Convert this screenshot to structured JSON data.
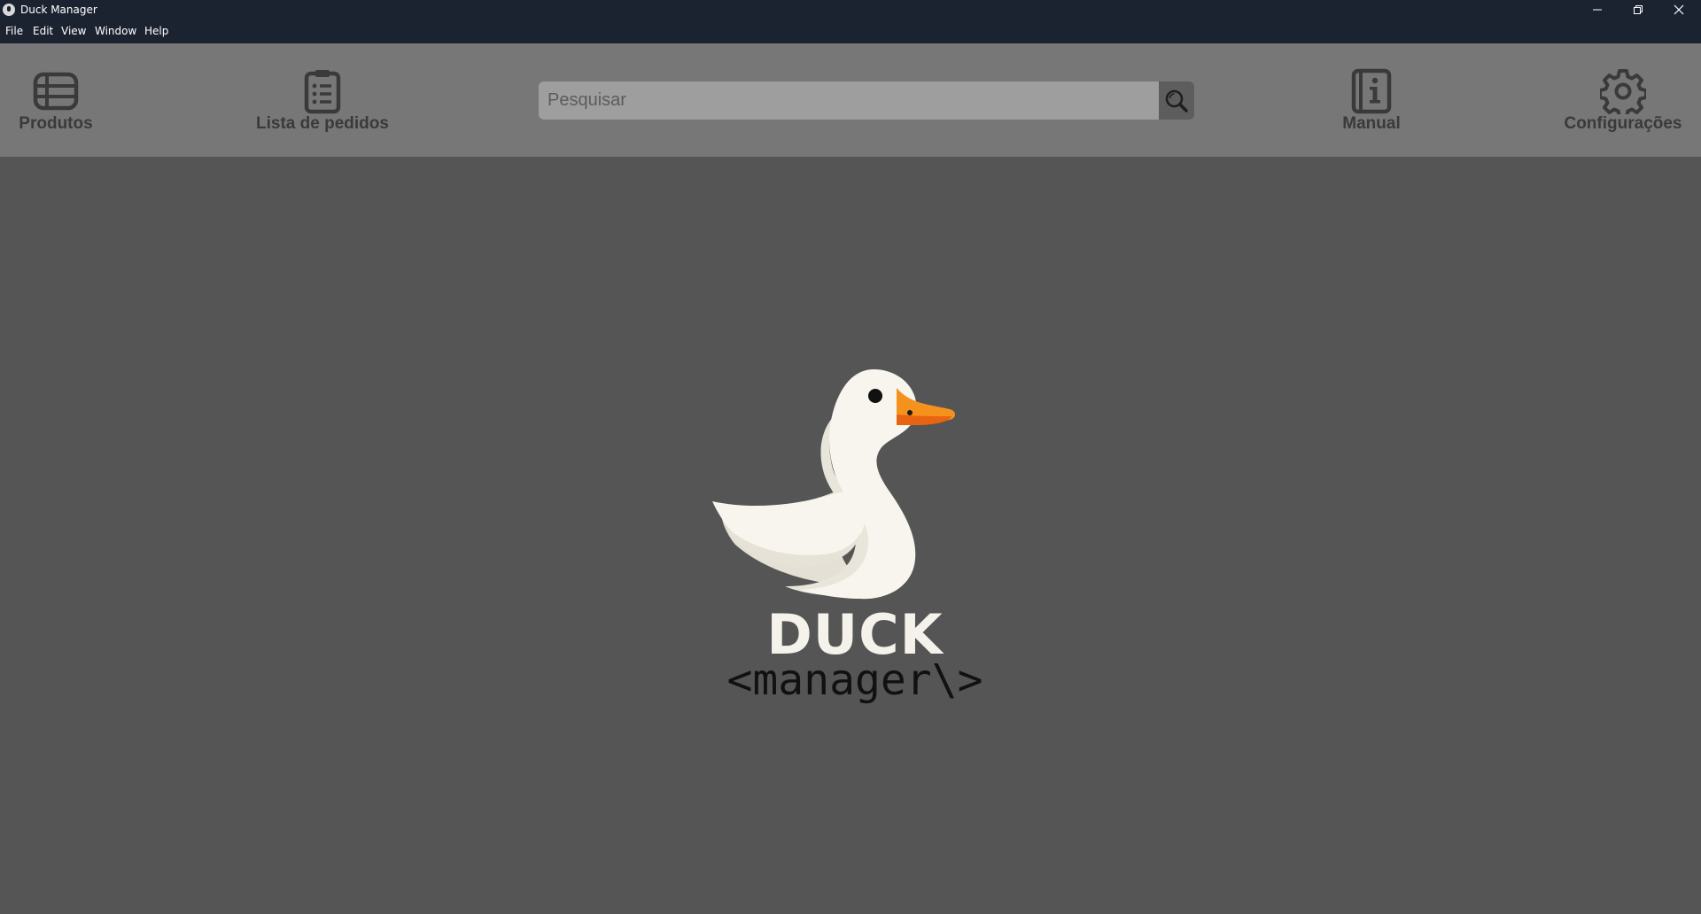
{
  "window": {
    "title": "Duck Manager"
  },
  "menu": {
    "items": [
      "File",
      "Edit",
      "View",
      "Window",
      "Help"
    ]
  },
  "toolbar": {
    "produtos_label": "Produtos",
    "pedidos_label": "Lista de pedidos",
    "manual_label": "Manual",
    "config_label": "Configurações"
  },
  "search": {
    "placeholder": "Pesquisar",
    "value": ""
  },
  "logo": {
    "word": "DUCK",
    "sub": "<manager\\>"
  },
  "colors": {
    "titlebar": "#1c2330",
    "toolbar": "#777777",
    "background": "#555555",
    "search_field": "#9e9e9e",
    "search_button": "#5d5d5d",
    "beak": "#f07d12"
  },
  "icons": {
    "produtos": "table-list-icon",
    "pedidos": "clipboard-list-icon",
    "search": "search-icon",
    "manual": "info-book-icon",
    "config": "gear-icon"
  }
}
